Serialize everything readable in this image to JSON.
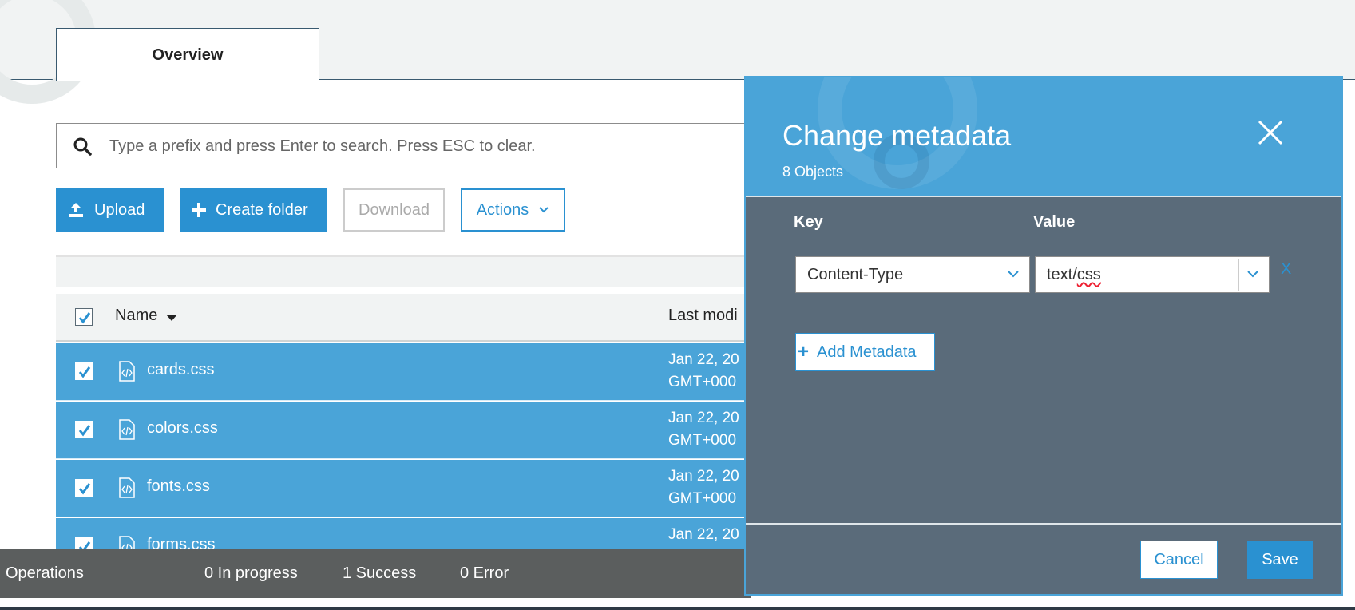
{
  "tabs": {
    "overview_label": "Overview"
  },
  "search": {
    "placeholder": "Type a prefix and press Enter to search. Press ESC to clear."
  },
  "toolbar": {
    "upload_label": "Upload",
    "create_folder_label": "Create folder",
    "download_label": "Download",
    "actions_label": "Actions"
  },
  "table": {
    "columns": {
      "name": "Name",
      "last_modified": "Last modi"
    },
    "rows": [
      {
        "name": "cards.css",
        "date_line1": "Jan 22, 20",
        "date_line2": "GMT+000"
      },
      {
        "name": "colors.css",
        "date_line1": "Jan 22, 20",
        "date_line2": "GMT+000"
      },
      {
        "name": "fonts.css",
        "date_line1": "Jan 22, 20",
        "date_line2": "GMT+000"
      },
      {
        "name": "forms.css",
        "date_line1": "Jan 22, 20",
        "date_line2": ""
      }
    ]
  },
  "operations": {
    "label": "Operations",
    "in_progress": "0 In progress",
    "success": "1 Success",
    "error": "0 Error"
  },
  "modal": {
    "title": "Change metadata",
    "subtitle": "8 Objects",
    "key_header": "Key",
    "value_header": "Value",
    "key_selected": "Content-Type",
    "value_prefix": "text/",
    "value_suffix": "css",
    "remove_label": "X",
    "add_label": "Add Metadata",
    "cancel_label": "Cancel",
    "save_label": "Save"
  },
  "colors": {
    "accent": "#2a91d1",
    "row_selected": "#4aa4d8",
    "modal_body": "#5a6b7a",
    "ops_bar": "#5b5e5e"
  }
}
